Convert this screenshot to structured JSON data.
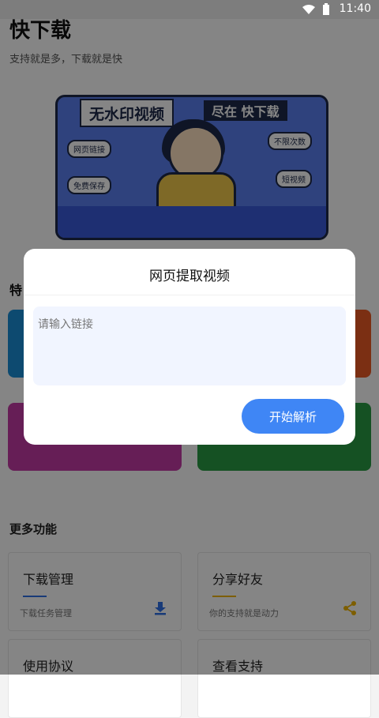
{
  "status_bar": {
    "time": "11:40"
  },
  "header": {
    "title": "快下载",
    "subtitle": "支持就是多，下载就是快"
  },
  "banner": {
    "headline": "无水印视频",
    "headline_tail": "尽在 快下载",
    "tags": [
      "网页链接",
      "不限次数",
      "免费保存",
      "短视频"
    ]
  },
  "features_title": "特",
  "more_functions": {
    "title": "更多功能",
    "items": [
      {
        "title": "下载管理",
        "desc": "下载任务管理",
        "icon": "download-icon",
        "accent": "#2f6fe6"
      },
      {
        "title": "分享好友",
        "desc": "你的支持就是动力",
        "icon": "share-icon",
        "accent": "#f0b400"
      },
      {
        "title": "使用协议",
        "desc": "",
        "icon": "",
        "accent": ""
      },
      {
        "title": "查看支持",
        "desc": "",
        "icon": "",
        "accent": ""
      }
    ]
  },
  "dialog": {
    "title": "网页提取视频",
    "input_placeholder": "请输入链接",
    "input_value": "",
    "submit_label": "开始解析"
  },
  "colors": {
    "primary": "#3f86f5",
    "overlay": "rgba(0,0,0,0.48)",
    "input_bg": "#f1f5ff"
  }
}
